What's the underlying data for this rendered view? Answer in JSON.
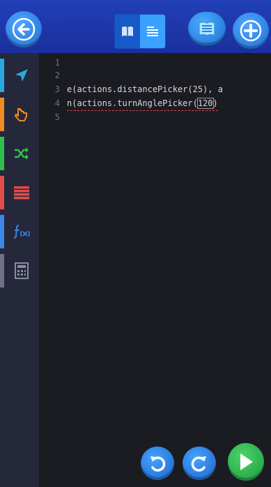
{
  "toolbar": {
    "back_icon": "arrow-left-icon",
    "view_toggle": {
      "blocks_icon": "book-icon",
      "text_icon": "text-lines-icon",
      "active": "text"
    },
    "hint_icon": "lightbulb-icon",
    "add_icon": "plus-icon"
  },
  "sidebar": {
    "categories": [
      {
        "icon": "navigation-arrow-icon",
        "color": "#29a8e0"
      },
      {
        "icon": "pointing-hand-icon",
        "color": "#f08a24"
      },
      {
        "icon": "shuffle-icon",
        "color": "#2fbf4a"
      },
      {
        "icon": "stacked-bars-icon",
        "color": "#e34b4b"
      },
      {
        "icon": "function-icon",
        "color": "#3b86e8"
      },
      {
        "icon": "calculator-icon",
        "color": "#707088"
      }
    ]
  },
  "editor": {
    "lines": [
      {
        "num": "1",
        "code": ""
      },
      {
        "num": "2",
        "code": ""
      },
      {
        "num": "3",
        "code_a": "e(actions.distancePicker(25), a",
        "code_b": "",
        "code_c": ""
      },
      {
        "num": "4",
        "code_a": "n(actions.turnAnglePicker(",
        "code_b": "120",
        "code_c": ")"
      },
      {
        "num": "5",
        "code": ""
      }
    ]
  },
  "controls": {
    "undo_icon": "undo-icon",
    "redo_icon": "redo-icon",
    "run_icon": "play-icon"
  },
  "colors": {
    "topbar": "#1b35a8",
    "accent_blue": "#2f8df0",
    "run_green": "#1d9a3b",
    "error_underline": "#e0474d"
  }
}
